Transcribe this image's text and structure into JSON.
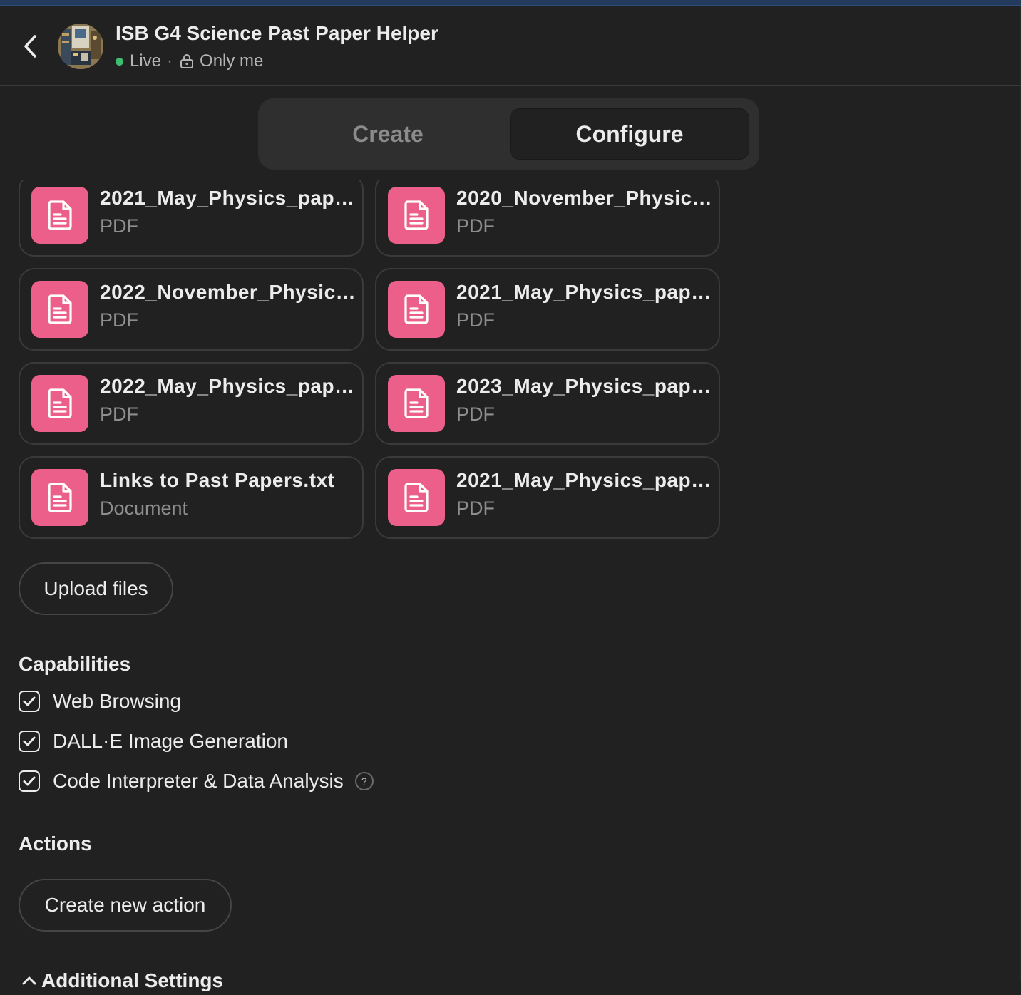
{
  "header": {
    "title": "ISB G4 Science Past Paper Helper",
    "status": "Live",
    "separator": "·",
    "visibility": "Only me"
  },
  "tabs": [
    {
      "label": "Create",
      "active": false
    },
    {
      "label": "Configure",
      "active": true
    }
  ],
  "files": [
    {
      "name": "2021_May_Physics_paper...",
      "type": "PDF"
    },
    {
      "name": "2020_November_Physics...",
      "type": "PDF"
    },
    {
      "name": "2022_November_Physics...",
      "type": "PDF"
    },
    {
      "name": "2021_May_Physics_paper...",
      "type": "PDF"
    },
    {
      "name": "2022_May_Physics_paper...",
      "type": "PDF"
    },
    {
      "name": "2023_May_Physics_paper...",
      "type": "PDF"
    },
    {
      "name": "Links to Past Papers.txt",
      "type": "Document"
    },
    {
      "name": "2021_May_Physics_paper...",
      "type": "PDF"
    }
  ],
  "upload_label": "Upload files",
  "capabilities": {
    "title": "Capabilities",
    "items": [
      {
        "label": "Web Browsing",
        "checked": true
      },
      {
        "label": "DALL·E Image Generation",
        "checked": true
      },
      {
        "label": "Code Interpreter & Data Analysis",
        "checked": true,
        "help": "?"
      }
    ]
  },
  "actions": {
    "title": "Actions",
    "create_label": "Create new action"
  },
  "additional_settings_label": "Additional Settings",
  "colors": {
    "background": "#212121",
    "file_icon": "#ec5f8a",
    "live_dot": "#3dbd6f"
  }
}
